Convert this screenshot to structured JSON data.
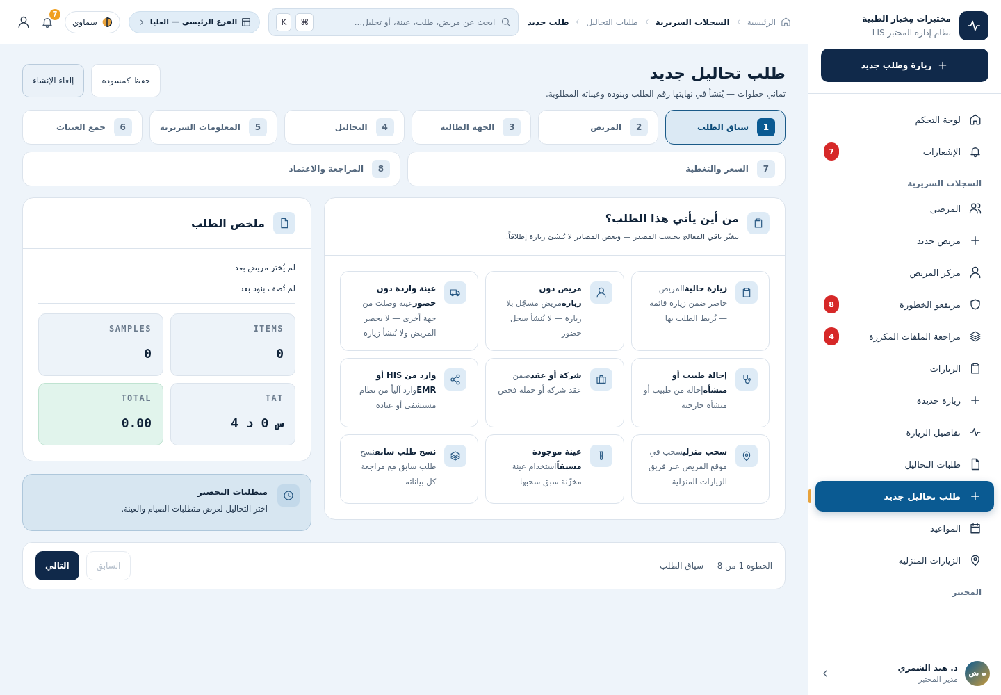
{
  "sidebar": {
    "brand": {
      "name": "مختبرات مِخبار الطبية",
      "subtitle": "نظام إدارة المختبر LIS"
    },
    "new_button": {
      "label": "زيارة وطلب جديد"
    },
    "items": [
      {
        "kind": "item",
        "label": "لوحة التحكم",
        "selected": false
      },
      {
        "kind": "item",
        "label": "الإشعارات",
        "badge": "7",
        "selected": false
      },
      {
        "kind": "heading",
        "label": "السجلات السريرية"
      },
      {
        "kind": "item",
        "label": "المرضى",
        "selected": false
      },
      {
        "kind": "item",
        "label": "مريض جديد",
        "selected": false
      },
      {
        "kind": "item",
        "label": "مركز المريض",
        "selected": false
      },
      {
        "kind": "item",
        "label": "مرتفعو الخطورة",
        "badge": "8",
        "selected": false
      },
      {
        "kind": "item",
        "label": "مراجعة الملفات المكررة",
        "badge": "4",
        "selected": false
      },
      {
        "kind": "item",
        "label": "الزيارات",
        "selected": false
      },
      {
        "kind": "item",
        "label": "زيارة جديدة",
        "selected": false
      },
      {
        "kind": "item",
        "label": "تفاصيل الزيارة",
        "selected": false
      },
      {
        "kind": "item",
        "label": "طلبات التحاليل",
        "selected": false
      },
      {
        "kind": "item",
        "label": "طلب تحاليل جديد",
        "selected": true
      },
      {
        "kind": "item",
        "label": "المواعيد",
        "selected": false
      },
      {
        "kind": "item",
        "label": "الزيارات المنزلية",
        "selected": false
      },
      {
        "kind": "heading",
        "label": "المختبر"
      }
    ],
    "user": {
      "initials": "ه ش",
      "name": "د. هند الشمري",
      "role": "مدير المختبر"
    }
  },
  "topbar": {
    "breadcrumbs": [
      {
        "label": "الرئيسية",
        "kind": "link"
      },
      {
        "label": "السجلات السريرية",
        "kind": "group"
      },
      {
        "label": "طلبات التحاليل",
        "kind": "link"
      },
      {
        "label": "طلب جديد",
        "kind": "current"
      }
    ],
    "search": {
      "placeholder": "ابحث عن مريض، طلب، عينة، أو تحليل...",
      "keys": [
        "⌘",
        "K"
      ]
    },
    "branch": "الفرع الرئيسي — العليا",
    "theme": "سماوي",
    "notifications": "7"
  },
  "page": {
    "title": "طلب تحاليل جديد",
    "subtitle": "ثماني خطوات — يُنشأ في نهايتها رقم الطلب وبنوده وعيناته المطلوبة.",
    "actions": [
      "حفظ كمسودة",
      "إلغاء الإنشاء"
    ]
  },
  "steps": [
    {
      "number": "1",
      "label": "سياق الطلب",
      "selected": true
    },
    {
      "number": "2",
      "label": "المريض",
      "selected": false
    },
    {
      "number": "3",
      "label": "الجهة الطالبة",
      "selected": false
    },
    {
      "number": "4",
      "label": "التحاليل",
      "selected": false
    },
    {
      "number": "5",
      "label": "المعلومات السريرية",
      "selected": false
    },
    {
      "number": "6",
      "label": "جمع العينات",
      "selected": false
    },
    {
      "number": "7",
      "label": "السعر والتغطية",
      "selected": false
    },
    {
      "number": "8",
      "label": "المراجعة والاعتماد",
      "selected": false
    }
  ],
  "source": {
    "title": "من أين يأتي هذا الطلب؟",
    "subtitle": "يتغيّر باقي المعالج بحسب المصدر — وبعض المصادر لا تُنشئ زيارة إطلاقاً.",
    "options": [
      {
        "text": "**زيارة حالية**المريض حاضر ضمن زيارة قائمة — يُربط الطلب بها"
      },
      {
        "text": "**مريض دون زيارة**مريض مسجّل بلا زيارة — لا يُنشأ سجل حضور"
      },
      {
        "text": "**عينة واردة دون حضور**عينة وصلت من جهة أخرى — لا يحضر المريض ولا تُنشأ زيارة"
      },
      {
        "text": "**إحالة طبيب أو منشأة**إحالة من طبيب أو منشأة خارجية"
      },
      {
        "text": "**شركة أو عقد**ضمن عقد شركة أو حملة فحص"
      },
      {
        "text": "**وارد من HIS أو EMR**وارد آلياً من نظام مستشفى أو عيادة"
      },
      {
        "text": "**سحب منزلي**سحب في موقع المريض عبر فريق الزيارات المنزلية"
      },
      {
        "text": "**عينة موجودة مسبقاً**استخدام عينة مخزّنة سبق سحبها"
      },
      {
        "text": "**نسخ طلب سابق**نسخ طلب سابق مع مراجعة كل بياناته"
      }
    ]
  },
  "summary": {
    "title": "ملخص الطلب",
    "notes": [
      "لم يُختر مريض بعد",
      "لم تُضف بنود بعد"
    ],
    "stats": [
      {
        "label": "ITEMS",
        "value": "0",
        "highlight": false
      },
      {
        "label": "SAMPLES",
        "value": "0",
        "highlight": false
      },
      {
        "label": "TAT",
        "value": "س 0 د 4",
        "highlight": false
      },
      {
        "label": "TOTAL",
        "value": "0.00",
        "highlight": true
      }
    ]
  },
  "prep": {
    "title": "متطلبات التحضير",
    "text": "اختر التحاليل لعرض متطلبات الصيام والعينة."
  },
  "footer": {
    "status": "الخطوة 1 من 8 — سياق الطلب",
    "previous": {
      "label": "السابق",
      "disabled": true
    },
    "next": {
      "label": "التالي",
      "disabled": false
    }
  }
}
